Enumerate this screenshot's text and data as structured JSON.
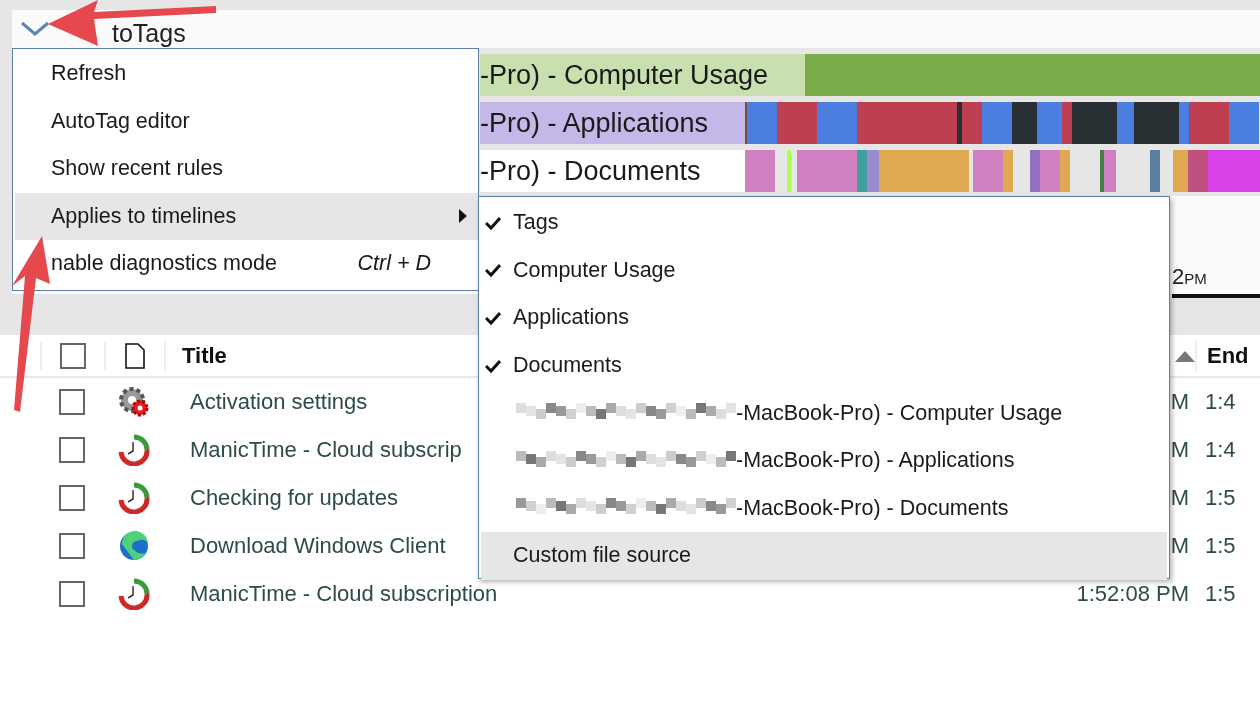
{
  "timeline": {
    "group_title": "toTags",
    "expanded": true,
    "rows": [
      {
        "label": "-Pro) - Computer Usage",
        "kind": "usage"
      },
      {
        "label": "-Pro) - Applications",
        "kind": "applications"
      },
      {
        "label": "-Pro) - Documents",
        "kind": "documents"
      }
    ],
    "axis_label": {
      "hour": "2",
      "suffix": "PM"
    }
  },
  "menu": {
    "items": [
      {
        "label": "Refresh",
        "selected": false
      },
      {
        "label": "AutoTag editor",
        "selected": false
      },
      {
        "label": "Show recent rules",
        "selected": false
      },
      {
        "label": "Applies to timelines",
        "selected": true,
        "has_submenu": true
      },
      {
        "label": "nable diagnostics mode",
        "shortcut": "Ctrl + D",
        "selected": false
      }
    ]
  },
  "submenu": {
    "items": [
      {
        "label": "Tags",
        "checked": true,
        "selected": false
      },
      {
        "label": "Computer Usage",
        "checked": true,
        "selected": false
      },
      {
        "label": "Applications",
        "checked": true,
        "selected": false
      },
      {
        "label": "Documents",
        "checked": true,
        "selected": false
      },
      {
        "label": "-MacBook-Pro) - Computer Usage",
        "checked": false,
        "blurred": true,
        "selected": false
      },
      {
        "label": "-MacBook-Pro) - Applications",
        "checked": false,
        "blurred": true,
        "selected": false
      },
      {
        "label": "-MacBook-Pro) - Documents",
        "checked": false,
        "blurred": true,
        "selected": false
      },
      {
        "label": "Custom file source",
        "checked": false,
        "selected": true
      }
    ]
  },
  "table": {
    "select_all": {
      "checked": false
    },
    "columns": [
      {
        "label": "Title"
      },
      {
        "label": "End"
      }
    ],
    "rows": [
      {
        "checked": false,
        "kind": "gear",
        "title": "Activation settings",
        "start": "M",
        "end": "1:4"
      },
      {
        "checked": false,
        "kind": "clock",
        "title": "ManicTime - Cloud subscrip",
        "start": "M",
        "end": "1:4"
      },
      {
        "checked": false,
        "kind": "clock",
        "title": "Checking for updates",
        "start": "M",
        "end": "1:5"
      },
      {
        "checked": false,
        "kind": "browser",
        "title": "Download Windows Client",
        "start": "M",
        "end": "1:5"
      },
      {
        "checked": false,
        "kind": "clock",
        "title": "ManicTime - Cloud subscription",
        "start": "1:52:08 PM",
        "end": "1:5"
      }
    ]
  }
}
